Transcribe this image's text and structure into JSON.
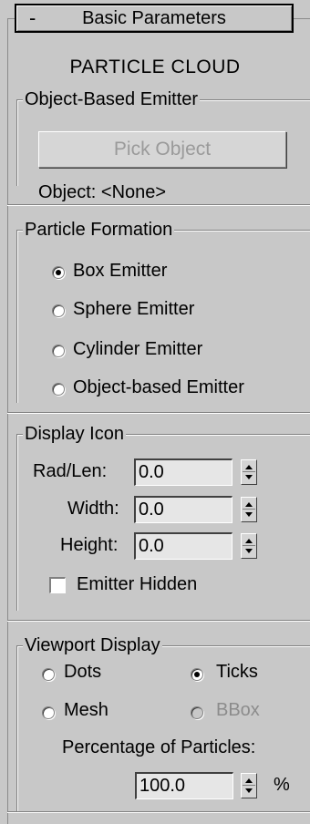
{
  "rollout": {
    "toggle": "-",
    "title": "Basic Parameters"
  },
  "heading": "PARTICLE CLOUD",
  "object_emitter": {
    "group_label": "Object-Based Emitter",
    "pick_button": "Pick Object",
    "object_text": "Object: <None>"
  },
  "formation": {
    "group_label": "Particle Formation",
    "options": [
      {
        "label": "Box Emitter",
        "selected": true
      },
      {
        "label": "Sphere Emitter",
        "selected": false
      },
      {
        "label": "Cylinder Emitter",
        "selected": false
      },
      {
        "label": "Object-based Emitter",
        "selected": false
      }
    ]
  },
  "display_icon": {
    "group_label": "Display Icon",
    "rad_len_label": "Rad/Len:",
    "rad_len_value": "0.0",
    "width_label": "Width:",
    "width_value": "0.0",
    "height_label": "Height:",
    "height_value": "0.0",
    "emitter_hidden_label": "Emitter Hidden",
    "emitter_hidden_checked": false
  },
  "viewport": {
    "group_label": "Viewport Display",
    "dots_label": "Dots",
    "ticks_label": "Ticks",
    "mesh_label": "Mesh",
    "bbox_label": "BBox",
    "selected": "Ticks",
    "percentage_label": "Percentage of Particles:",
    "percentage_value": "100.0",
    "percent_unit": "%"
  }
}
